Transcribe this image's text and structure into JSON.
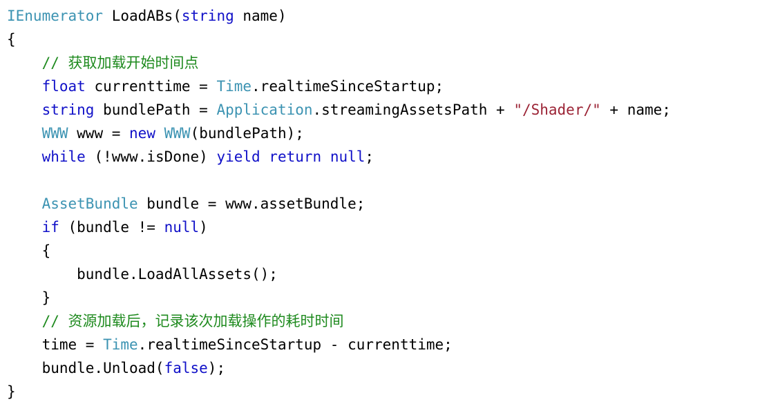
{
  "editor": {
    "language": "csharp",
    "background": "#ffffff",
    "font_size_px": 21,
    "line_height_px": 34,
    "tab_width": 4
  },
  "colors": {
    "plain": "#000000",
    "keyword": "#1010C8",
    "type": "#3C93B2",
    "string": "#9B2335",
    "comment": "#1E8A1E"
  },
  "code": {
    "full_text": "IEnumerator LoadABs(string name)\n{\n    // 获取加载开始时间点\n    float currenttime = Time.realtimeSinceStartup;\n    string bundlePath = Application.streamingAssetsPath + \"/Shader/\" + name;\n    WWW www = new WWW(bundlePath);\n    while (!www.isDone) yield return null;\n\n    AssetBundle bundle = www.assetBundle;\n    if (bundle != null)\n    {\n        bundle.LoadAllAssets();\n    }\n    // 资源加载后，记录该次加载操作的耗时时间\n    time = Time.realtimeSinceStartup - currenttime;\n    bundle.Unload(false);\n}",
    "lines": [
      {
        "number": 1,
        "tokens": [
          {
            "text": "IEnumerator",
            "kind": "type"
          },
          {
            "text": " LoadABs(",
            "kind": "plain"
          },
          {
            "text": "string",
            "kind": "keyword"
          },
          {
            "text": " name)",
            "kind": "plain"
          }
        ]
      },
      {
        "number": 2,
        "tokens": [
          {
            "text": "{",
            "kind": "punct"
          }
        ]
      },
      {
        "number": 3,
        "tokens": [
          {
            "text": "    ",
            "kind": "plain"
          },
          {
            "text": "// 获取加载开始时间点",
            "kind": "comment"
          }
        ]
      },
      {
        "number": 4,
        "tokens": [
          {
            "text": "    ",
            "kind": "plain"
          },
          {
            "text": "float",
            "kind": "keyword"
          },
          {
            "text": " currenttime = ",
            "kind": "plain"
          },
          {
            "text": "Time",
            "kind": "type"
          },
          {
            "text": ".realtimeSinceStartup;",
            "kind": "plain"
          }
        ]
      },
      {
        "number": 5,
        "tokens": [
          {
            "text": "    ",
            "kind": "plain"
          },
          {
            "text": "string",
            "kind": "keyword"
          },
          {
            "text": " bundlePath = ",
            "kind": "plain"
          },
          {
            "text": "Application",
            "kind": "type"
          },
          {
            "text": ".streamingAssetsPath + ",
            "kind": "plain"
          },
          {
            "text": "\"/Shader/\"",
            "kind": "string"
          },
          {
            "text": " + name;",
            "kind": "plain"
          }
        ]
      },
      {
        "number": 6,
        "tokens": [
          {
            "text": "    ",
            "kind": "plain"
          },
          {
            "text": "WWW",
            "kind": "type"
          },
          {
            "text": " www = ",
            "kind": "plain"
          },
          {
            "text": "new",
            "kind": "keyword"
          },
          {
            "text": " ",
            "kind": "plain"
          },
          {
            "text": "WWW",
            "kind": "type"
          },
          {
            "text": "(bundlePath);",
            "kind": "plain"
          }
        ]
      },
      {
        "number": 7,
        "tokens": [
          {
            "text": "    ",
            "kind": "plain"
          },
          {
            "text": "while",
            "kind": "keyword"
          },
          {
            "text": " (!www.isDone) ",
            "kind": "plain"
          },
          {
            "text": "yield return null",
            "kind": "keyword"
          },
          {
            "text": ";",
            "kind": "plain"
          }
        ]
      },
      {
        "number": 8,
        "tokens": []
      },
      {
        "number": 9,
        "tokens": [
          {
            "text": "    ",
            "kind": "plain"
          },
          {
            "text": "AssetBundle",
            "kind": "type"
          },
          {
            "text": " bundle = www.assetBundle;",
            "kind": "plain"
          }
        ]
      },
      {
        "number": 10,
        "tokens": [
          {
            "text": "    ",
            "kind": "plain"
          },
          {
            "text": "if",
            "kind": "keyword"
          },
          {
            "text": " (bundle != ",
            "kind": "plain"
          },
          {
            "text": "null",
            "kind": "keyword"
          },
          {
            "text": ")",
            "kind": "plain"
          }
        ]
      },
      {
        "number": 11,
        "tokens": [
          {
            "text": "    {",
            "kind": "punct"
          }
        ]
      },
      {
        "number": 12,
        "tokens": [
          {
            "text": "        bundle.LoadAllAssets();",
            "kind": "plain"
          }
        ]
      },
      {
        "number": 13,
        "tokens": [
          {
            "text": "    }",
            "kind": "punct"
          }
        ]
      },
      {
        "number": 14,
        "tokens": [
          {
            "text": "    ",
            "kind": "plain"
          },
          {
            "text": "// 资源加载后，记录该次加载操作的耗时时间",
            "kind": "comment"
          }
        ]
      },
      {
        "number": 15,
        "tokens": [
          {
            "text": "    time = ",
            "kind": "plain"
          },
          {
            "text": "Time",
            "kind": "type"
          },
          {
            "text": ".realtimeSinceStartup - currenttime;",
            "kind": "plain"
          }
        ]
      },
      {
        "number": 16,
        "tokens": [
          {
            "text": "    bundle.Unload(",
            "kind": "plain"
          },
          {
            "text": "false",
            "kind": "keyword"
          },
          {
            "text": ");",
            "kind": "plain"
          }
        ]
      },
      {
        "number": 17,
        "tokens": [
          {
            "text": "}",
            "kind": "punct"
          }
        ]
      }
    ]
  }
}
